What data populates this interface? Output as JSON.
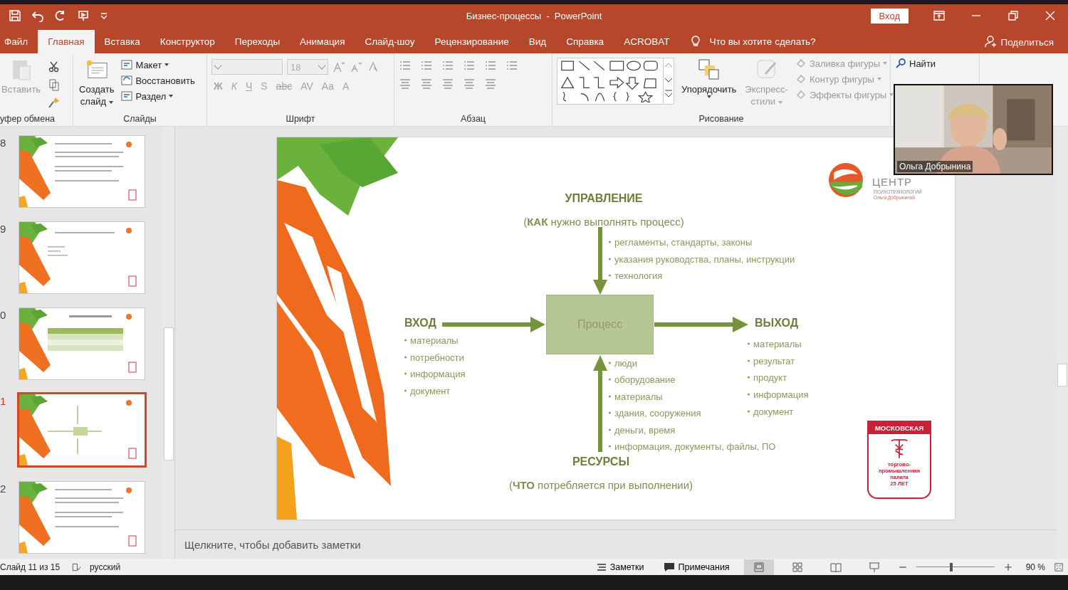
{
  "title_bar": {
    "title": "Бизнес-процессы  -  PowerPoint",
    "sign_in": "Вход"
  },
  "tabs": [
    {
      "label": "Файл",
      "selected": false
    },
    {
      "label": "Главная",
      "selected": true
    },
    {
      "label": "Вставка",
      "selected": false
    },
    {
      "label": "Конструктор",
      "selected": false
    },
    {
      "label": "Переходы",
      "selected": false
    },
    {
      "label": "Анимация",
      "selected": false
    },
    {
      "label": "Слайд-шоу",
      "selected": false
    },
    {
      "label": "Рецензирование",
      "selected": false
    },
    {
      "label": "Вид",
      "selected": false
    },
    {
      "label": "Справка",
      "selected": false
    },
    {
      "label": "ACROBAT",
      "selected": false
    }
  ],
  "tell_me": "Что вы хотите сделать?",
  "share": "Поделиться",
  "ribbon": {
    "clipboard": {
      "label": "уфер обмена",
      "paste": {
        "label": "Вставить",
        "disabled": true
      }
    },
    "slides": {
      "label": "Слайды",
      "new_slide": [
        "Создать",
        "слайд"
      ],
      "items": [
        "Макет",
        "Восстановить",
        "Раздел"
      ]
    },
    "font": {
      "label": "Шрифт",
      "size": "18",
      "disabled": true,
      "buttons": [
        "Ж",
        "К",
        "Ч",
        "S",
        "abc",
        "AV",
        "Aa",
        "A"
      ]
    },
    "paragraph": {
      "label": "Абзац"
    },
    "drawing": {
      "label": "Рисование",
      "arrange": "Упорядочить",
      "quick_styles": {
        "lines": [
          "Экспресс-",
          "стили"
        ],
        "disabled": true
      },
      "format": [
        {
          "label": "Заливка фигуры",
          "disabled": true
        },
        {
          "label": "Контур фигуры",
          "disabled": true
        },
        {
          "label": "Эффекты фигуры",
          "disabled": true
        }
      ]
    },
    "editing": {
      "find": "Найти"
    }
  },
  "thumbnails": [
    {
      "number": "8",
      "kind": "text",
      "selected": false
    },
    {
      "number": "9",
      "kind": "bullets",
      "selected": false
    },
    {
      "number": "0",
      "kind": "table",
      "selected": false
    },
    {
      "number": "1",
      "kind": "diagram",
      "selected": true
    },
    {
      "number": "2",
      "kind": "text",
      "selected": false
    }
  ],
  "slide": {
    "control": {
      "title": "УПРАВЛЕНИЕ",
      "subtitle": "(**КАК** нужно выполнять процесс)",
      "items": [
        "регламенты, стандарты, законы",
        "указания руководства, планы, инструкции",
        "технология"
      ]
    },
    "input": {
      "title": "ВХОД",
      "items": [
        "материалы",
        "потребности",
        "информация",
        "документ"
      ]
    },
    "process": "Процесс",
    "output": {
      "title": "ВЫХОД",
      "items": [
        "материалы",
        "результат",
        "продукт",
        "информация",
        "документ"
      ]
    },
    "resources": {
      "title": "РЕСУРСЫ",
      "subtitle": "(**ЧТО** потребляется при выполнении)",
      "items": [
        "люди",
        "оборудование",
        "материалы",
        "здания, сооружения",
        "деньги, время",
        "информация, документы, файлы, ПО"
      ]
    },
    "logo": {
      "name": "ЦЕНТР",
      "line1": "ПСИХОТЕХНОЛОГИЙ",
      "line2": "Ольга Добрыниной"
    },
    "badge": {
      "top": "МОСКОВСКАЯ",
      "lines": [
        "торгово-",
        "промышленная",
        "палата",
        "25 ЛЕТ"
      ]
    }
  },
  "notes_placeholder": "Щелкните, чтобы добавить заметки",
  "status_bar": {
    "slide": "Слайд 11 из 15",
    "language": "русский",
    "notes": "Заметки",
    "comments": "Примечания",
    "zoom": "90 %",
    "zoom_slider": {
      "level": 0.45
    }
  },
  "video": {
    "kind": "picture",
    "name": "Ольга Добрынина"
  }
}
